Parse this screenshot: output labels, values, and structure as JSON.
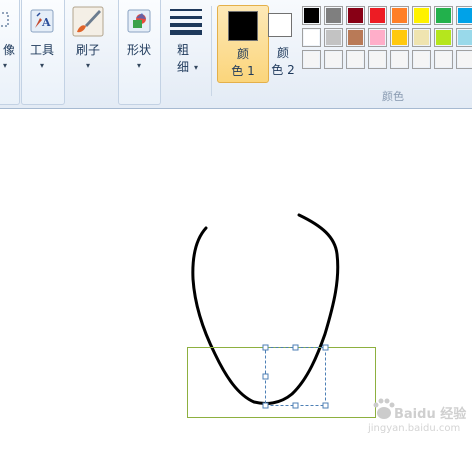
{
  "ribbon": {
    "image_group": {
      "label": "像"
    },
    "tools": {
      "label": "工具"
    },
    "brushes": {
      "label": "刷子"
    },
    "shapes": {
      "label": "形状"
    },
    "size": {
      "label": "粗\n细"
    },
    "color1": {
      "label": "颜\n色 1",
      "color": "#000000"
    },
    "color2": {
      "label": "颜\n色 2",
      "color": "#ffffff"
    },
    "colors_group_label": "颜色",
    "palette": [
      [
        "#000000",
        "#7f7f7f",
        "#880015",
        "#ed1c24",
        "#ff7f27",
        "#fff200",
        "#22b14c",
        "#00a2e8"
      ],
      [
        "#ffffff",
        "#c3c3c3",
        "#b97a57",
        "#ffaec9",
        "#ffc90e",
        "#efe4b0",
        "#b5e61d",
        "#99d9ea"
      ],
      [
        "#f5f5f5",
        "#f5f5f5",
        "#f5f5f5",
        "#f5f5f5",
        "#f5f5f5",
        "#f5f5f5",
        "#f5f5f5",
        "#f5f5f5"
      ]
    ]
  },
  "canvas": {
    "stroke_color": "#000000",
    "selection_color": "#8db03f",
    "handle_color": "#4d7fb5"
  },
  "watermark": {
    "text": "Baidu 经验",
    "url": "jingyan.baidu.com"
  }
}
